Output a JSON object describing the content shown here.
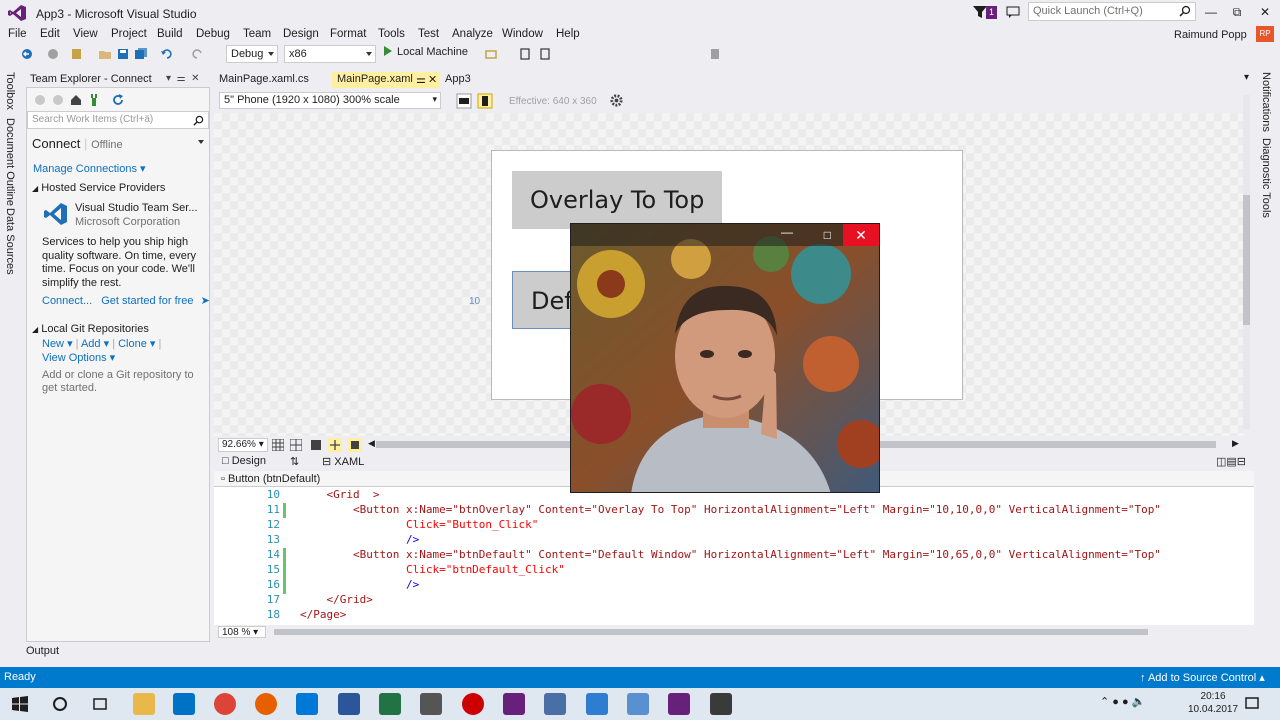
{
  "window": {
    "title": "App3 - Microsoft Visual Studio",
    "notification_count": "1",
    "quick_launch_placeholder": "Quick Launch (Ctrl+Q)",
    "user_name": "Raimund Popp",
    "user_initials": "RP",
    "brand_color": "#68217a"
  },
  "menu": [
    "File",
    "Edit",
    "View",
    "Project",
    "Build",
    "Debug",
    "Team",
    "Design",
    "Format",
    "Tools",
    "Test",
    "Analyze",
    "Window",
    "Help"
  ],
  "toolbar": {
    "configuration": "Debug",
    "platform": "x86",
    "run_target": "Local Machine"
  },
  "left_tabs": [
    "Toolbox",
    "Document Outline",
    "Data Sources"
  ],
  "right_tabs": [
    "Notifications",
    "Diagnostic Tools"
  ],
  "team_explorer": {
    "title": "Team Explorer - Connect",
    "search_placeholder": "Search Work Items (Ctrl+ä)",
    "page": "Connect",
    "state": "Offline",
    "manage_connections": "Manage Connections",
    "hosted_header": "Hosted Service Providers",
    "service_name": "Visual Studio Team Ser...",
    "service_company": "Microsoft Corporation",
    "service_desc": "Services to help you ship high quality software. On time, every time. Focus on your code. We'll simplify the rest.",
    "connect_link": "Connect...",
    "get_started_link": "Get started for free",
    "git_header": "Local Git Repositories",
    "git_new": "New",
    "git_add": "Add",
    "git_clone": "Clone",
    "git_view_options": "View Options",
    "git_desc": "Add or clone a Git repository to get started."
  },
  "doc_tabs": [
    {
      "label": "MainPage.xaml.cs",
      "active": false
    },
    {
      "label": "MainPage.xaml",
      "active": true
    },
    {
      "label": "App3",
      "active": false
    }
  ],
  "designer": {
    "device": "5\" Phone (1920 x 1080) 300% scale",
    "effective": "Effective: 640 x 360",
    "btn_overlay": "Overlay To Top",
    "btn_default": "Default Window",
    "margin_label": "10",
    "zoom": "92.66%"
  },
  "split": {
    "design_tab": "Design",
    "xaml_tab": "XAML",
    "nav_element": "Button (btnDefault)"
  },
  "code_lines": [
    {
      "n": "10",
      "text": "    <Grid  >"
    },
    {
      "n": "11",
      "text": "        <Button x:Name=\"btnOverlay\" Content=\"Overlay To Top\" HorizontalAlignment=\"Left\" Margin=\"10,10,0,0\" VerticalAlignment=\"Top\""
    },
    {
      "n": "12",
      "text": "                Click=\"Button_Click\""
    },
    {
      "n": "13",
      "text": "                />"
    },
    {
      "n": "14",
      "text": "        <Button x:Name=\"btnDefault\" Content=\"Default Window\" HorizontalAlignment=\"Left\" Margin=\"10,65,0,0\" VerticalAlignment=\"Top\""
    },
    {
      "n": "15",
      "text": "                Click=\"btnDefault_Click\""
    },
    {
      "n": "16",
      "text": "                />"
    },
    {
      "n": "17",
      "text": "    </Grid>"
    },
    {
      "n": "18",
      "text": "</Page>"
    }
  ],
  "editor_zoom": "108 %",
  "output_tab": "Output",
  "status": {
    "text": "Ready",
    "source_control": "Add to Source Control",
    "color": "#007acc"
  },
  "taskbar": {
    "time": "20:16",
    "date": "10.04.2017"
  }
}
